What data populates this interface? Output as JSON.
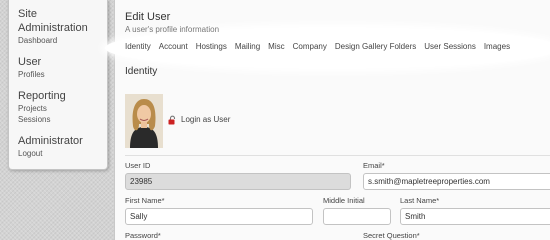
{
  "sidebar": {
    "groups": [
      {
        "title": "Site Administration",
        "links": [
          "Dashboard"
        ]
      },
      {
        "title": "User",
        "links": [
          "Profiles"
        ]
      },
      {
        "title": "Reporting",
        "links": [
          "Projects",
          "Sessions"
        ]
      },
      {
        "title": "Administrator",
        "links": [
          "Logout"
        ]
      }
    ]
  },
  "main": {
    "title": "Edit User",
    "subtitle": "A user's profile information",
    "tabs": [
      "Identity",
      "Account",
      "Hostings",
      "Mailing",
      "Misc",
      "Company",
      "Design Gallery Folders",
      "User Sessions",
      "Images"
    ],
    "section_title": "Identity",
    "login_as_label": "Login as User",
    "fields": {
      "user_id": {
        "label": "User ID",
        "value": "23985"
      },
      "email": {
        "label": "Email*",
        "value": "s.smith@mapletreeproperties.com"
      },
      "first_name": {
        "label": "First Name*",
        "value": "Sally"
      },
      "middle_initial": {
        "label": "Middle Initial",
        "value": ""
      },
      "last_name": {
        "label": "Last Name*",
        "value": "Smith"
      },
      "password": {
        "label": "Password*"
      },
      "secret_question": {
        "label": "Secret Question*"
      }
    }
  },
  "colors": {
    "background": "#d3d3d3",
    "panel": "#fafafa",
    "readonly_input": "#dcdcdc",
    "lock_icon": "#cc2222"
  }
}
